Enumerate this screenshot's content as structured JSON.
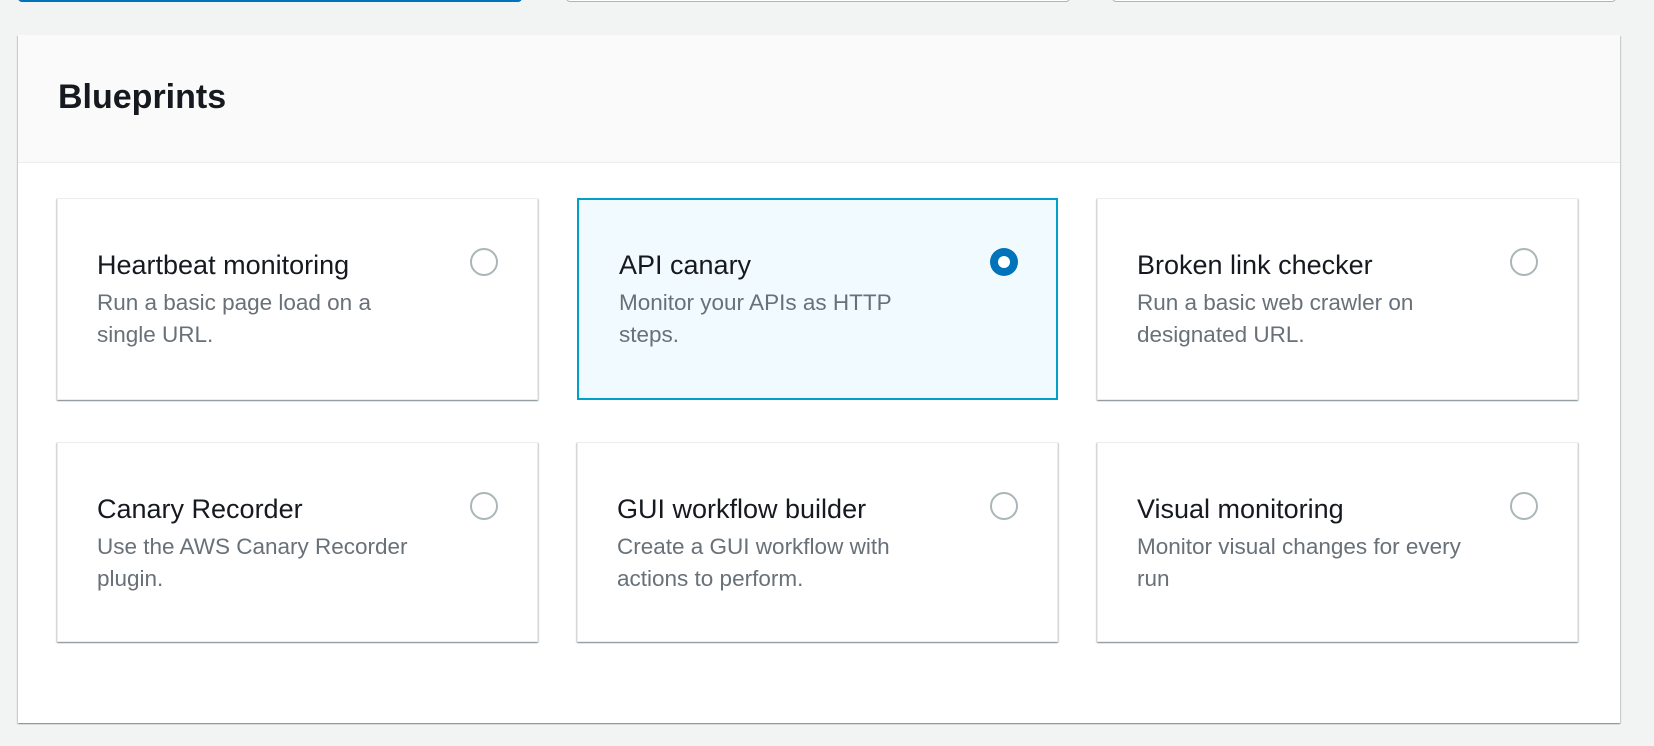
{
  "panel": {
    "title": "Blueprints"
  },
  "blueprints": [
    {
      "title": "Heartbeat monitoring",
      "description": "Run a basic page load on a single URL.",
      "selected": false
    },
    {
      "title": "API canary",
      "description": "Monitor your APIs as HTTP steps.",
      "selected": true
    },
    {
      "title": "Broken link checker",
      "description": "Run a basic web crawler on designated URL.",
      "selected": false
    },
    {
      "title": "Canary Recorder",
      "description": "Use the AWS Canary Recorder plugin.",
      "selected": false
    },
    {
      "title": "GUI workflow builder",
      "description": "Create a GUI workflow with actions to perform.",
      "selected": false
    },
    {
      "title": "Visual monitoring",
      "description": "Monitor visual changes for every run",
      "selected": false
    }
  ],
  "colors": {
    "accent": "#0073bb",
    "selected_border": "#00a1c9",
    "selected_background": "#f1faff",
    "description_text": "#687078"
  }
}
